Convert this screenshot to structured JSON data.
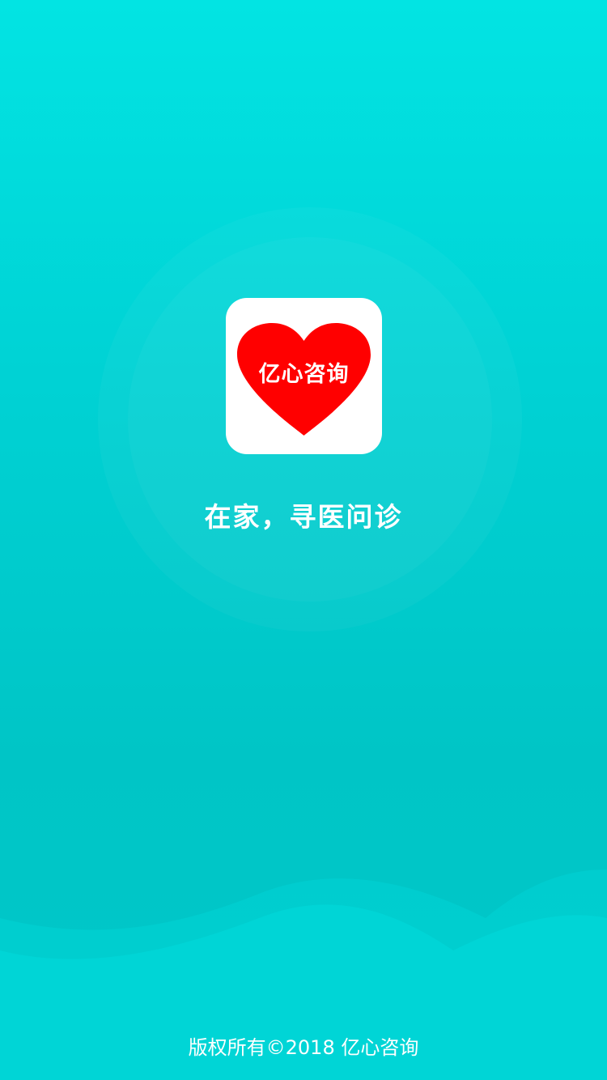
{
  "app": {
    "logo_text": "亿心咨询",
    "tagline": "在家，寻医问诊",
    "copyright": "版权所有©2018 亿心咨询"
  },
  "icons": {
    "logo": "heart-logo-icon"
  },
  "colors": {
    "background_top": "#02e4e3",
    "background_bottom": "#00c5c6",
    "heart": "#ff0000",
    "logo_tile": "#ffffff",
    "text": "#ffffff"
  }
}
